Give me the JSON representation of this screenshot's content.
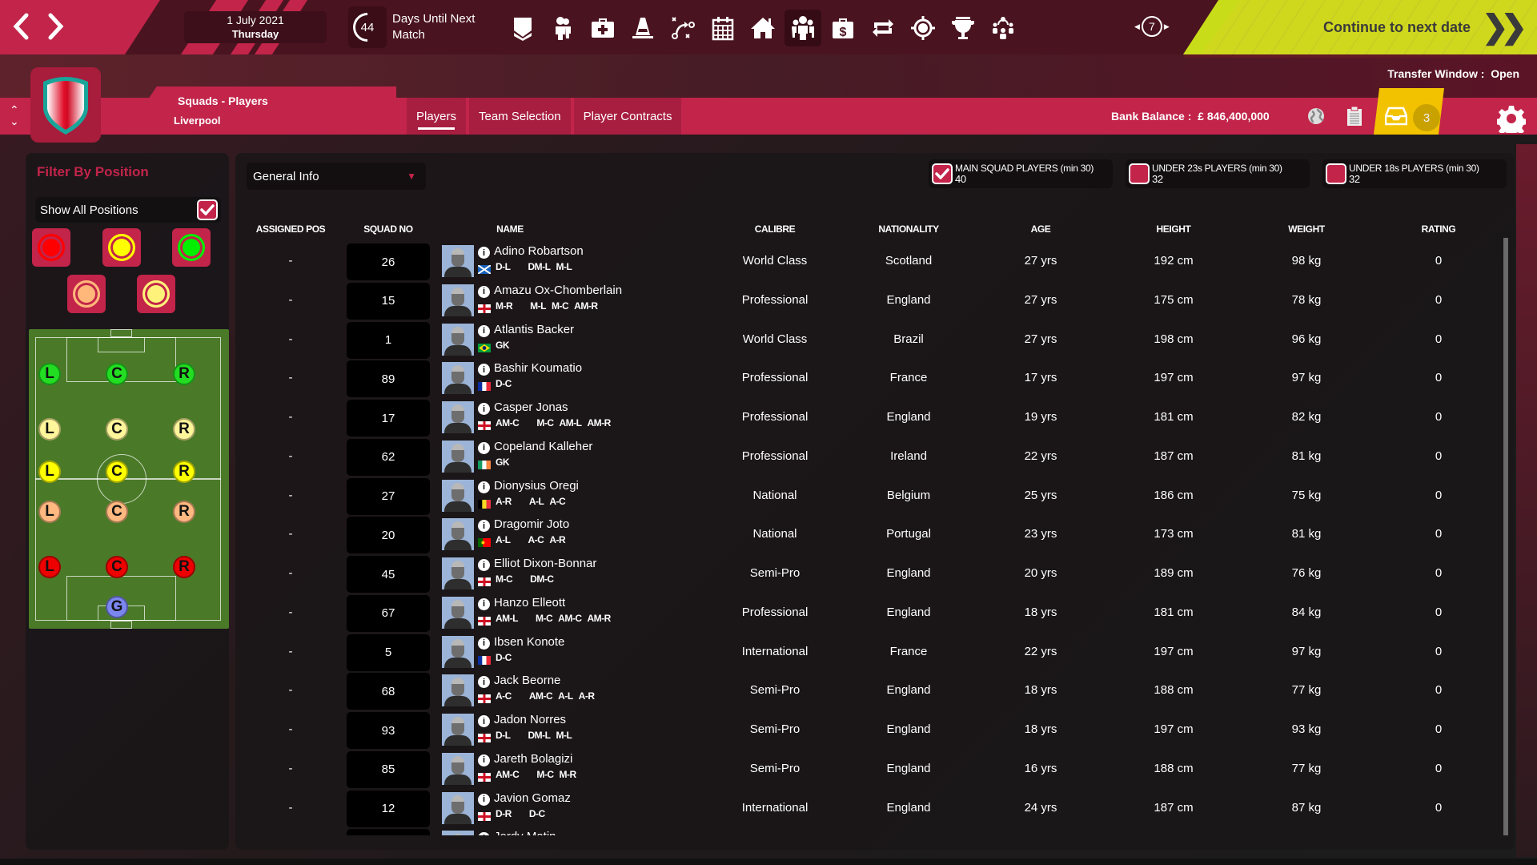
{
  "topbar": {
    "back_icon": "chevron-left-icon",
    "forward_icon": "chevron-right-icon",
    "date": "1 July 2021",
    "day_of_week": "Thursday",
    "days_until_next_match": "44",
    "days_until_label": "Days Until Next Match",
    "nav_icons": [
      {
        "name": "club-badge-icon"
      },
      {
        "name": "staff-icon"
      },
      {
        "name": "medical-icon"
      },
      {
        "name": "training-cone-icon"
      },
      {
        "name": "tactics-icon"
      },
      {
        "name": "calendar-icon"
      },
      {
        "name": "home-icon"
      },
      {
        "name": "squad-icon",
        "active": true
      },
      {
        "name": "finances-icon"
      },
      {
        "name": "transfers-icon"
      },
      {
        "name": "scouting-icon"
      },
      {
        "name": "trophy-icon"
      },
      {
        "name": "board-meeting-icon"
      }
    ],
    "game_speed": "7",
    "continue_label": "Continue to next date"
  },
  "header": {
    "transfer_window_label": "Transfer Window :",
    "transfer_window_status": "Open",
    "page_title": "Squads - Players",
    "club_name": "Liverpool",
    "tabs": [
      {
        "label": "Players",
        "active": true
      },
      {
        "label": "Team Selection",
        "active": false
      },
      {
        "label": "Player Contracts",
        "active": false
      }
    ],
    "bank_balance_label": "Bank Balance :",
    "bank_balance": "£ 846,400,000",
    "inbox_count": "3"
  },
  "filter_panel": {
    "title": "Filter By Position",
    "show_all_label": "Show All Positions",
    "show_all_checked": true,
    "color_filters": [
      "#ff0000",
      "#ffff00",
      "#00ee00",
      "#ffb87a",
      "#fff27a"
    ],
    "pitch_rows": [
      {
        "color": "#22dd22",
        "labels": [
          "L",
          "C",
          "R"
        ]
      },
      {
        "color": "#fff59a",
        "labels": [
          "L",
          "C",
          "R"
        ]
      },
      {
        "color": "#ffff00",
        "labels": [
          "L",
          "C",
          "R"
        ]
      },
      {
        "color": "#ffb880",
        "labels": [
          "L",
          "C",
          "R"
        ]
      },
      {
        "color": "#ee0000",
        "labels": [
          "L",
          "C",
          "R"
        ]
      },
      {
        "color": "#7b86f0",
        "labels": [
          "G"
        ]
      }
    ]
  },
  "main": {
    "view_select": "General Info",
    "squad_filters": [
      {
        "label": "MAIN SQUAD PLAYERS (min 30)",
        "count": "40",
        "checked": true
      },
      {
        "label": "UNDER 23s PLAYERS (min 30)",
        "count": "32",
        "checked": false
      },
      {
        "label": "UNDER 18s PLAYERS (min 30)",
        "count": "32",
        "checked": false
      }
    ],
    "columns": [
      "ASSIGNED POS",
      "SQUAD NO",
      "NAME",
      "CALIBRE",
      "NATIONALITY",
      "AGE",
      "HEIGHT",
      "WEIGHT",
      "RATING"
    ],
    "players": [
      {
        "assigned": "-",
        "no": "26",
        "name": "Adino Robartson",
        "flag": "scotland",
        "positions": [
          "D-L",
          "DM-L",
          "M-L"
        ],
        "calibre": "World Class",
        "nationality": "Scotland",
        "age": "27 yrs",
        "height": "192 cm",
        "weight": "98 kg",
        "rating": "0"
      },
      {
        "assigned": "-",
        "no": "15",
        "name": "Amazu Ox-Chomberlain",
        "flag": "england",
        "positions": [
          "M-R",
          "M-L",
          "M-C",
          "AM-R"
        ],
        "calibre": "Professional",
        "nationality": "England",
        "age": "27 yrs",
        "height": "175 cm",
        "weight": "78 kg",
        "rating": "0"
      },
      {
        "assigned": "-",
        "no": "1",
        "name": "Atlantis Backer",
        "flag": "brazil",
        "positions": [
          "GK"
        ],
        "calibre": "World Class",
        "nationality": "Brazil",
        "age": "27 yrs",
        "height": "198 cm",
        "weight": "96 kg",
        "rating": "0"
      },
      {
        "assigned": "-",
        "no": "89",
        "name": "Bashir Koumatio",
        "flag": "france",
        "positions": [
          "D-C"
        ],
        "calibre": "Professional",
        "nationality": "France",
        "age": "17 yrs",
        "height": "197 cm",
        "weight": "97 kg",
        "rating": "0"
      },
      {
        "assigned": "-",
        "no": "17",
        "name": "Casper Jonas",
        "flag": "england",
        "positions": [
          "AM-C",
          "M-C",
          "AM-L",
          "AM-R"
        ],
        "calibre": "Professional",
        "nationality": "England",
        "age": "19 yrs",
        "height": "181 cm",
        "weight": "82 kg",
        "rating": "0"
      },
      {
        "assigned": "-",
        "no": "62",
        "name": "Copeland Kalleher",
        "flag": "ireland",
        "positions": [
          "GK"
        ],
        "calibre": "Professional",
        "nationality": "Ireland",
        "age": "22 yrs",
        "height": "187 cm",
        "weight": "81 kg",
        "rating": "0"
      },
      {
        "assigned": "-",
        "no": "27",
        "name": "Dionysius Oregi",
        "flag": "belgium",
        "positions": [
          "A-R",
          "A-L",
          "A-C"
        ],
        "calibre": "National",
        "nationality": "Belgium",
        "age": "25 yrs",
        "height": "186 cm",
        "weight": "75 kg",
        "rating": "0"
      },
      {
        "assigned": "-",
        "no": "20",
        "name": "Dragomir Joto",
        "flag": "portugal",
        "positions": [
          "A-L",
          "A-C",
          "A-R"
        ],
        "calibre": "National",
        "nationality": "Portugal",
        "age": "23 yrs",
        "height": "173 cm",
        "weight": "81 kg",
        "rating": "0"
      },
      {
        "assigned": "-",
        "no": "45",
        "name": "Elliot Dixon-Bonnar",
        "flag": "england",
        "positions": [
          "M-C",
          "DM-C"
        ],
        "calibre": "Semi-Pro",
        "nationality": "England",
        "age": "20 yrs",
        "height": "189 cm",
        "weight": "76 kg",
        "rating": "0"
      },
      {
        "assigned": "-",
        "no": "67",
        "name": "Hanzo Elleott",
        "flag": "england",
        "positions": [
          "AM-L",
          "M-C",
          "AM-C",
          "AM-R"
        ],
        "calibre": "Professional",
        "nationality": "England",
        "age": "18 yrs",
        "height": "181 cm",
        "weight": "84 kg",
        "rating": "0"
      },
      {
        "assigned": "-",
        "no": "5",
        "name": "Ibsen Konote",
        "flag": "france",
        "positions": [
          "D-C"
        ],
        "calibre": "International",
        "nationality": "France",
        "age": "22 yrs",
        "height": "197 cm",
        "weight": "97 kg",
        "rating": "0"
      },
      {
        "assigned": "-",
        "no": "68",
        "name": "Jack Beorne",
        "flag": "england",
        "positions": [
          "A-C",
          "AM-C",
          "A-L",
          "A-R"
        ],
        "calibre": "Semi-Pro",
        "nationality": "England",
        "age": "18 yrs",
        "height": "188 cm",
        "weight": "77 kg",
        "rating": "0"
      },
      {
        "assigned": "-",
        "no": "93",
        "name": "Jadon Norres",
        "flag": "england",
        "positions": [
          "D-L",
          "DM-L",
          "M-L"
        ],
        "calibre": "Semi-Pro",
        "nationality": "England",
        "age": "18 yrs",
        "height": "197 cm",
        "weight": "93 kg",
        "rating": "0"
      },
      {
        "assigned": "-",
        "no": "85",
        "name": "Jareth Bolagizi",
        "flag": "england",
        "positions": [
          "AM-C",
          "M-C",
          "M-R"
        ],
        "calibre": "Semi-Pro",
        "nationality": "England",
        "age": "16 yrs",
        "height": "188 cm",
        "weight": "77 kg",
        "rating": "0"
      },
      {
        "assigned": "-",
        "no": "12",
        "name": "Javion Gomaz",
        "flag": "england",
        "positions": [
          "D-R",
          "D-C"
        ],
        "calibre": "International",
        "nationality": "England",
        "age": "24 yrs",
        "height": "187 cm",
        "weight": "87 kg",
        "rating": "0"
      },
      {
        "assigned": "",
        "no": "",
        "name": "Jordy Matin",
        "flag": "england",
        "positions": [],
        "calibre": "",
        "nationality": "",
        "age": "",
        "height": "",
        "weight": "",
        "rating": ""
      }
    ]
  },
  "colors": {
    "crimson": "#c2244a",
    "maroon": "#4a1320",
    "lime": "#c8dc1a",
    "inbox_yellow": "#f2c200"
  }
}
